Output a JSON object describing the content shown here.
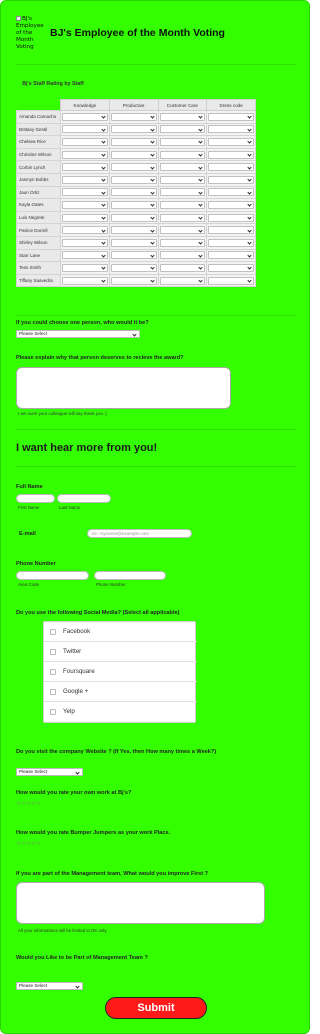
{
  "header": {
    "logo_alt": "BJ's Employee of the Month Voting",
    "title": "BJ's Employee of the Month Voting"
  },
  "matrix": {
    "caption": "Bj's Staff Rating by Staff",
    "columns": [
      "Knowledge",
      "Productive",
      "Customer Care",
      "Dress code"
    ],
    "rows": [
      "Amanda Camacho",
      "Brittany Gentil",
      "Chelsea Rice",
      "Christine Wilson",
      "Corbin Lynch",
      "Jasmyn Bobbs",
      "Jaun Ortiz",
      "Kayla Oates",
      "Luis Negrete",
      "Patrice Dorrell",
      "Shirley Wilson",
      "Starr Lane",
      "Tess Smith",
      "Tiffany Saavedra"
    ]
  },
  "choose": {
    "label": "If you could choose one person, who would it be?",
    "value": "Please Select"
  },
  "explain": {
    "label": "Please explain why that person deserves to recieve the award?",
    "hint": "I am sure! your colleague will say thank you :)"
  },
  "section_heading": "I want hear more from you!",
  "full_name": {
    "label": "Full Name",
    "first_sub": "First Name",
    "last_sub": "Last Name"
  },
  "email": {
    "label": "E-mail",
    "placeholder": "ex: myname@example.com"
  },
  "phone": {
    "label": "Phone Number",
    "area_sub": "Area Code",
    "number_sub": "Phone Number"
  },
  "social": {
    "label": "Do you use the following Social Media? (Select all applicable)",
    "options": [
      "Facebook",
      "Twitter",
      "Foursquare",
      "Google +",
      "Yelp"
    ]
  },
  "website": {
    "label": "Do you visit the company Website ? (If Yes, then How many times a Week?)",
    "value": "Please Select"
  },
  "rate_work": {
    "label": "How would you rate your own work at Bj's?",
    "stars": "☆☆☆☆☆"
  },
  "rate_place": {
    "label": "How would you rate Bumper Jumpers as your work Place.",
    "stars": "☆☆☆☆☆"
  },
  "improve": {
    "label": "If you are part of the Management team, What would you improve First ?",
    "hint": "All your informations will be limited to DK only."
  },
  "management": {
    "label": "Would you Like to be Part of Management Team ?",
    "value": "Please Select"
  },
  "submit_label": "Submit",
  "colors": {
    "page_background": "#33ff00",
    "submit_background": "#ff1a1a"
  }
}
